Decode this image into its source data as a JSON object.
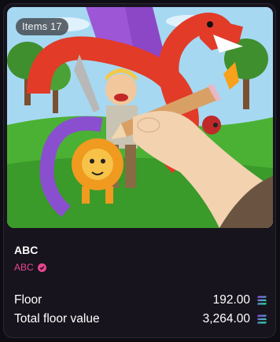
{
  "card": {
    "items_badge": "Items 17",
    "collection_name": "ABC",
    "creator_name": "ABC",
    "verified_icon": "verified-badge-icon",
    "accent_color": "#e8458f",
    "stats": [
      {
        "label": "Floor",
        "value": "192.00",
        "icon": "solana-icon"
      },
      {
        "label": "Total floor value",
        "value": "3,264.00",
        "icon": "solana-icon"
      }
    ]
  }
}
